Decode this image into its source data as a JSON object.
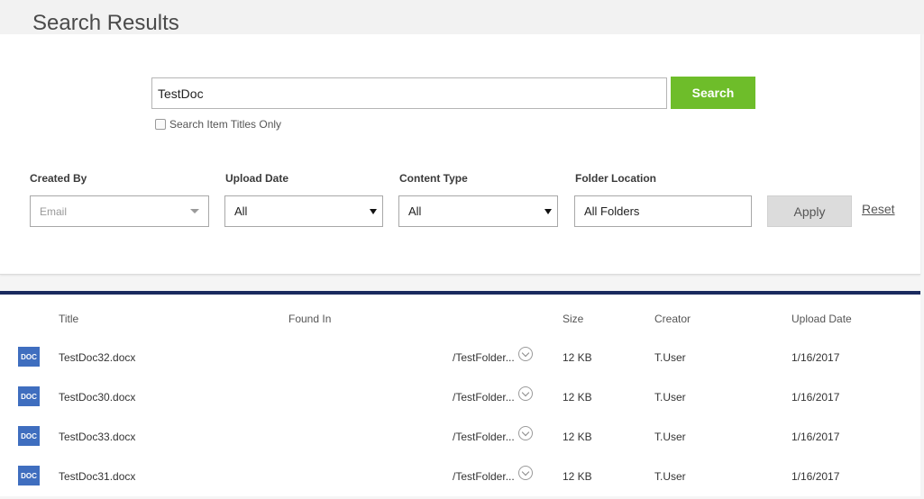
{
  "header": {
    "title": "Search Results"
  },
  "search": {
    "query": "TestDoc",
    "button_label": "Search",
    "titles_only_label": "Search Item Titles Only",
    "titles_only_checked": false
  },
  "filters": {
    "created_by": {
      "label": "Created By",
      "placeholder": "Email"
    },
    "upload_date": {
      "label": "Upload Date",
      "value": "All"
    },
    "content_type": {
      "label": "Content Type",
      "value": "All"
    },
    "folder_location": {
      "label": "Folder Location",
      "value": "All Folders"
    },
    "apply_label": "Apply",
    "reset_label": "Reset"
  },
  "results": {
    "columns": {
      "title": "Title",
      "found_in": "Found In",
      "size": "Size",
      "creator": "Creator",
      "upload_date": "Upload Date"
    },
    "rows": [
      {
        "icon_label": "DOC",
        "title": "TestDoc32.docx",
        "found_in": "/TestFolder...",
        "size": "12 KB",
        "creator": "T.User",
        "upload_date": "1/16/2017"
      },
      {
        "icon_label": "DOC",
        "title": "TestDoc30.docx",
        "found_in": "/TestFolder...",
        "size": "12 KB",
        "creator": "T.User",
        "upload_date": "1/16/2017"
      },
      {
        "icon_label": "DOC",
        "title": "TestDoc33.docx",
        "found_in": "/TestFolder...",
        "size": "12 KB",
        "creator": "T.User",
        "upload_date": "1/16/2017"
      },
      {
        "icon_label": "DOC",
        "title": "TestDoc31.docx",
        "found_in": "/TestFolder...",
        "size": "12 KB",
        "creator": "T.User",
        "upload_date": "1/16/2017"
      }
    ]
  },
  "colors": {
    "search_button": "#6ebd2a",
    "results_border": "#1a2a5e",
    "doc_icon": "#3f6ebf"
  }
}
